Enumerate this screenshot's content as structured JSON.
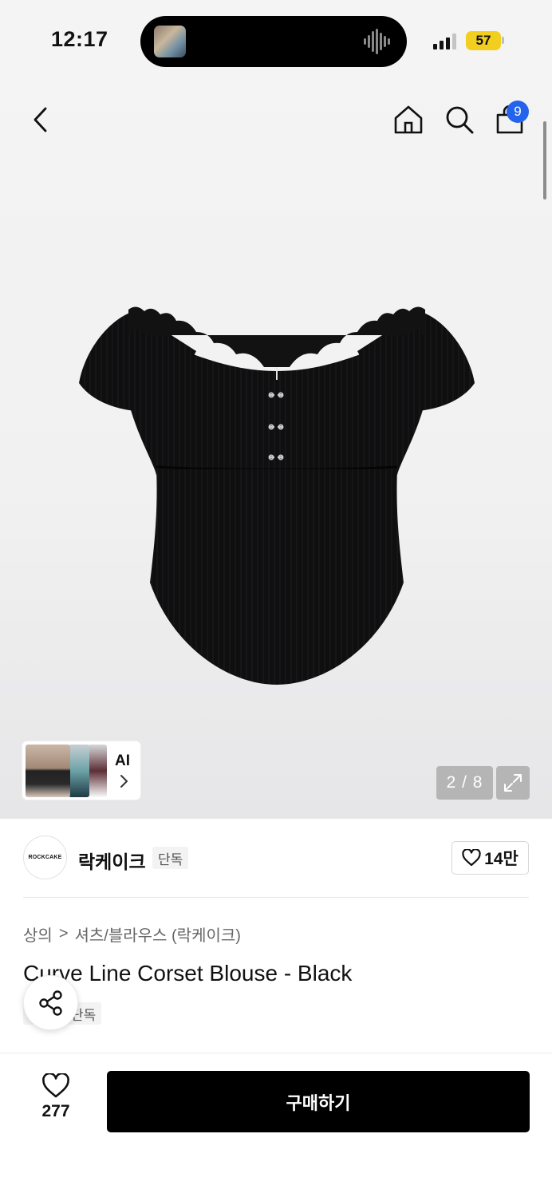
{
  "status_bar": {
    "time": "12:17",
    "battery": "57"
  },
  "nav": {
    "cart_count": "9"
  },
  "gallery": {
    "counter": "2 / 8",
    "ai_label": "AI"
  },
  "brand": {
    "logo_text": "ROCKCAKE",
    "name": "락케이크",
    "tag": "단독",
    "likes": "14만"
  },
  "breadcrumb": {
    "category": "상의",
    "separator": ">",
    "subcategory": "셔츠/블라우스 (락케이크)"
  },
  "product": {
    "title": "Curve Line Corset Blouse - Black",
    "exclusive_tag": "단독"
  },
  "bottom_bar": {
    "wish_count": "277",
    "buy_label": "구매하기"
  },
  "colors": {
    "accent": "#2463eb",
    "battery": "#f2cf1f",
    "buy_button": "#000000"
  }
}
